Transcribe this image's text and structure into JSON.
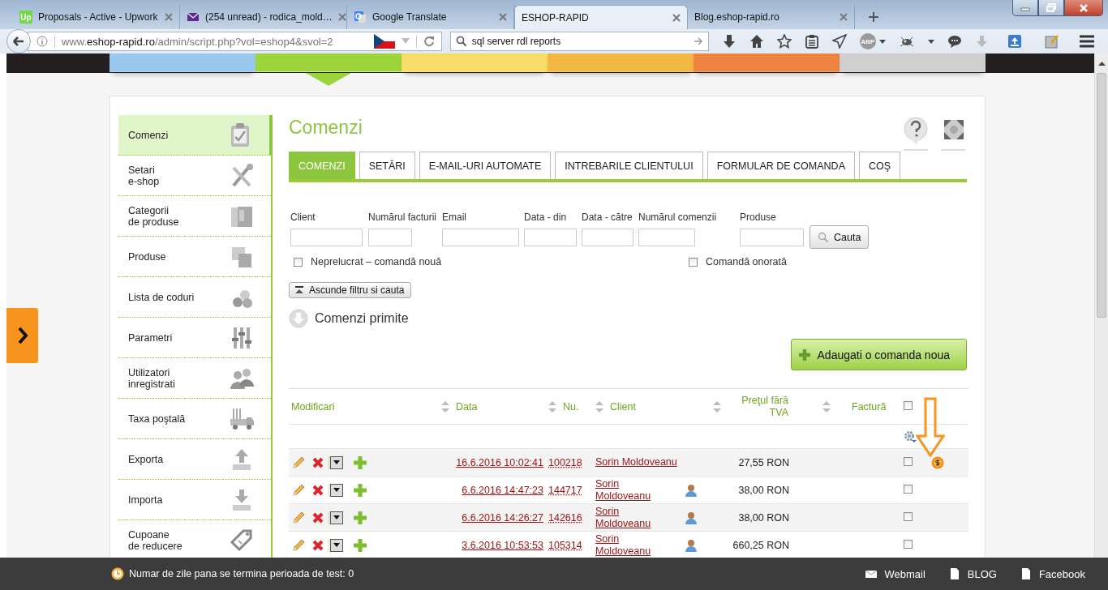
{
  "browser": {
    "tabs": [
      {
        "title": "Proposals - Active - Upwork",
        "badge": "Up",
        "selected": false
      },
      {
        "title": "(254 unread) - rodica_mold…",
        "selected": false
      },
      {
        "title": "Google Translate",
        "selected": false
      },
      {
        "title": "ESHOP-RAPID",
        "selected": true
      },
      {
        "title": "Blog.eshop-rapid.ro",
        "selected": false
      }
    ],
    "url": "www.**eshop-rapid.ro**/admin/script.php?vol=eshop4&svol=2",
    "search": "sql server rdl reports",
    "adblock_label": "ABP"
  },
  "top_menu": [
    {
      "color": "#98c8ee",
      "selected": false
    },
    {
      "color": "#9cd43c",
      "selected": true
    },
    {
      "color": "#f6dc68",
      "selected": false
    },
    {
      "color": "#f3b843",
      "selected": false
    },
    {
      "color": "#ec8340",
      "selected": false
    },
    {
      "color": "#cfcfcf",
      "selected": false
    }
  ],
  "sidebar": {
    "items": [
      {
        "label": "Comenzi",
        "selected": true
      },
      {
        "label": "Setari\ne-shop",
        "selected": false
      },
      {
        "label": "Categorii\nde produse",
        "selected": false
      },
      {
        "label": "Produse",
        "selected": false
      },
      {
        "label": "Lista de coduri",
        "selected": false
      },
      {
        "label": "Parametri",
        "selected": false
      },
      {
        "label": "Utilizatori\ninregistrati",
        "selected": false
      },
      {
        "label": "Taxa poştală",
        "selected": false
      },
      {
        "label": "Exporta",
        "selected": false
      },
      {
        "label": "Importa",
        "selected": false
      },
      {
        "label": "Cupoane\nde reducere",
        "selected": false
      }
    ]
  },
  "content": {
    "title": "Comenzi",
    "tabs": [
      {
        "label": "COMENZI",
        "selected": true
      },
      {
        "label": "SETĂRI",
        "selected": false
      },
      {
        "label": "E-MAIL-URI AUTOMATE",
        "selected": false
      },
      {
        "label": "INTREBARILE CLIENTULUI",
        "selected": false
      },
      {
        "label": "FORMULAR DE COMANDA",
        "selected": false
      },
      {
        "label": "COŞ",
        "selected": false
      }
    ],
    "filters": [
      {
        "label": "Client"
      },
      {
        "label": "Numărul facturii"
      },
      {
        "label": "Email"
      },
      {
        "label": "Data - din"
      },
      {
        "label": "Data - către"
      },
      {
        "label": "Numărul comenzii"
      },
      {
        "label": "Produse"
      }
    ],
    "search_button": "Cauta",
    "checkboxes": [
      {
        "label": "Neprelucrat – comandă nouă",
        "checked": false
      },
      {
        "label": "Comandă onorată",
        "checked": false
      }
    ],
    "hide_filter_button": "Ascunde filtru si cauta",
    "section_title": "Comenzi primite",
    "add_button": "Adaugati o comanda noua",
    "table": {
      "columns": [
        "Modificari",
        "Data",
        "Nu.",
        "Client",
        "Preţul fără TVA",
        "Factură"
      ],
      "all_checked": false,
      "rows": [
        {
          "date": "16.6.2016 10:02:41",
          "number": "100218",
          "client": "Sorin Moldoveanu",
          "price": "27,55 RON",
          "checked": false,
          "user_icon": false,
          "coin_icon": true
        },
        {
          "date": "6.6.2016 14:47:23",
          "number": "144717",
          "client": "Sorin Moldoveanu",
          "price": "38,00 RON",
          "checked": false,
          "user_icon": true,
          "coin_icon": false
        },
        {
          "date": "6.6.2016 14:26:27",
          "number": "142616",
          "client": "Sorin Moldoveanu",
          "price": "38,00 RON",
          "checked": false,
          "user_icon": true,
          "coin_icon": false
        },
        {
          "date": "3.6.2016 10:53:53",
          "number": "105314",
          "client": "Sorin Moldoveanu",
          "price": "660,25 RON",
          "checked": false,
          "user_icon": true,
          "coin_icon": false
        }
      ]
    }
  },
  "notice_bar": {
    "text": "Numar de zile pana se termina perioada de test: 0",
    "links": [
      "Webmail",
      "BLOG",
      "Facebook"
    ]
  }
}
